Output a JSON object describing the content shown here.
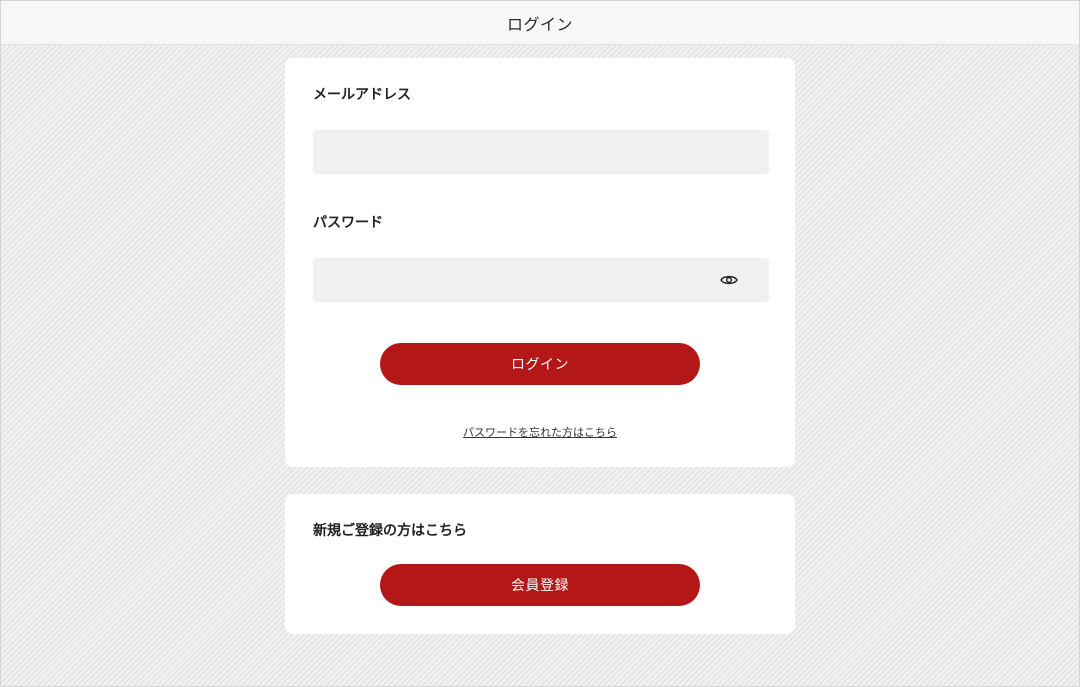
{
  "header": {
    "title": "ログイン"
  },
  "login_form": {
    "email_label": "メールアドレス",
    "email_value": "",
    "password_label": "パスワード",
    "password_value": "",
    "password_toggle_icon": "eye-icon",
    "submit_label": "ログイン",
    "forgot_password_link": "パスワードを忘れた方はこちら"
  },
  "register": {
    "heading": "新規ご登録の方はこちら",
    "button_label": "会員登録"
  },
  "colors": {
    "accent": "#b31717",
    "input_background": "#f0f0f0",
    "card_background": "#ffffff"
  }
}
